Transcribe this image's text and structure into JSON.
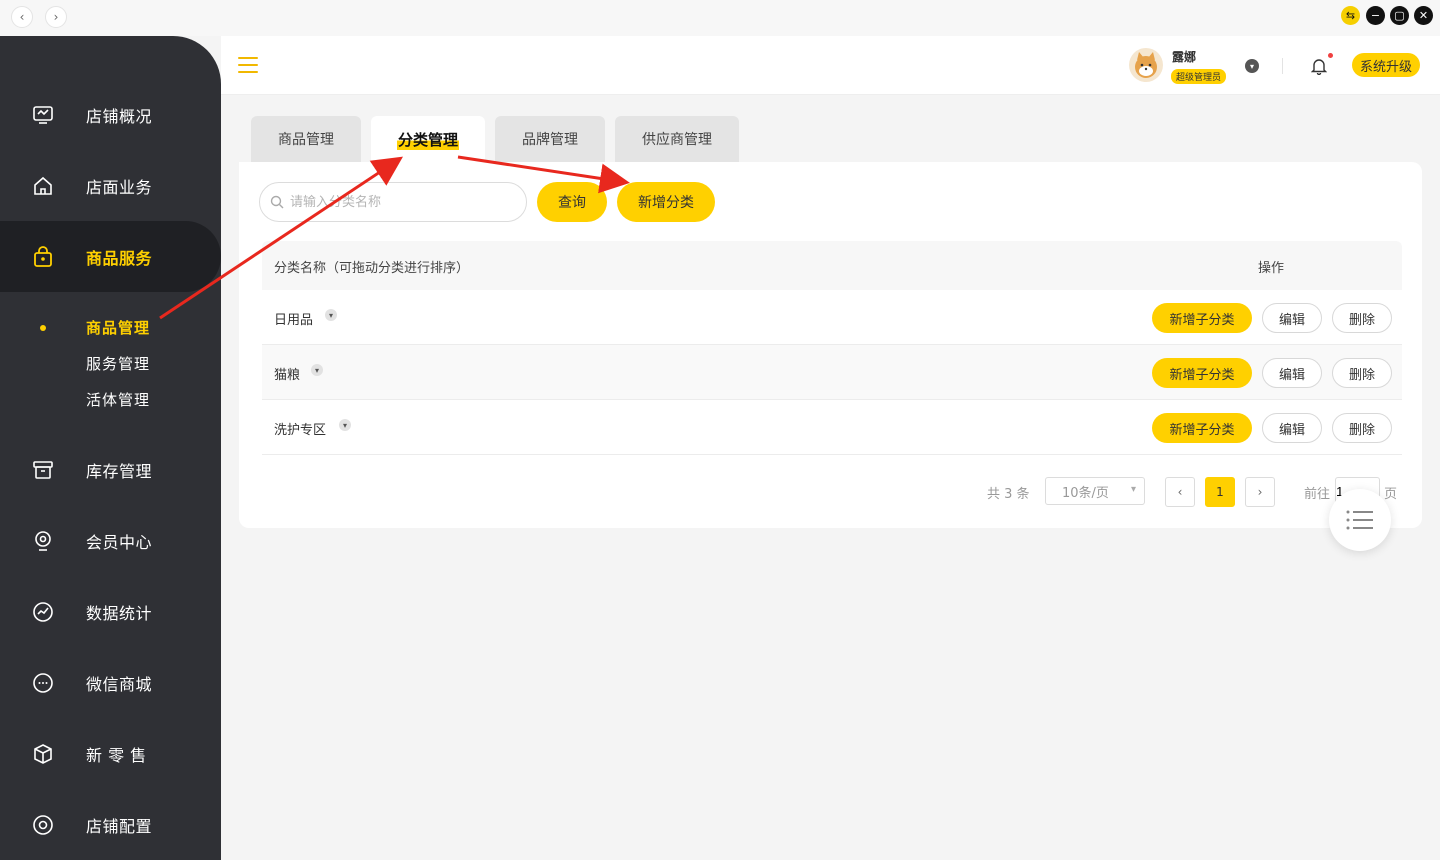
{
  "titlebar": {
    "back_icon": "chevron-left-icon",
    "forward_icon": "chevron-right-icon",
    "window_buttons": [
      "switch-icon",
      "minimize-icon",
      "maximize-icon",
      "close-icon"
    ]
  },
  "sidebar": {
    "items": [
      {
        "label": "店铺概况",
        "icon": "monitor-icon"
      },
      {
        "label": "店面业务",
        "icon": "home-icon"
      },
      {
        "label": "商品服务",
        "icon": "bag-icon",
        "active": true
      },
      {
        "label": "库存管理",
        "icon": "archive-icon"
      },
      {
        "label": "会员中心",
        "icon": "member-icon"
      },
      {
        "label": "数据统计",
        "icon": "chart-icon"
      },
      {
        "label": "微信商城",
        "icon": "chat-icon"
      },
      {
        "label": "新 零 售",
        "icon": "box-icon"
      },
      {
        "label": "店铺配置",
        "icon": "settings-icon"
      }
    ],
    "submenu": [
      {
        "label": "商品管理",
        "active": true
      },
      {
        "label": "服务管理"
      },
      {
        "label": "活体管理"
      }
    ]
  },
  "header": {
    "user_name": "露娜",
    "user_role": "超级管理员",
    "upgrade_label": "系统升级"
  },
  "tabs": [
    {
      "label": "商品管理"
    },
    {
      "label": "分类管理",
      "active": true
    },
    {
      "label": "品牌管理"
    },
    {
      "label": "供应商管理"
    }
  ],
  "toolbar": {
    "search_placeholder": "请输入分类名称",
    "query_label": "查询",
    "add_category_label": "新增分类"
  },
  "table": {
    "col_name": "分类名称（可拖动分类进行排序）",
    "col_actions": "操作",
    "rows": [
      {
        "name": "日用品"
      },
      {
        "name": "猫粮"
      },
      {
        "name": "洗护专区"
      }
    ],
    "add_sub_label": "新增子分类",
    "edit_label": "编辑",
    "delete_label": "删除"
  },
  "pagination": {
    "total": "共 3 条",
    "page_size": "10条/页",
    "current_page": "1",
    "goto_label": "前往",
    "goto_value": "1",
    "page_suffix": "页"
  },
  "colors": {
    "accent": "#ffd000",
    "sidebar_bg": "#2f3035",
    "annotation_arrow": "#e8281e"
  }
}
